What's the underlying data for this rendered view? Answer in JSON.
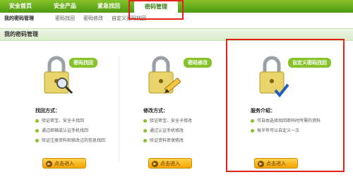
{
  "topnav": {
    "tabs": [
      {
        "label": "安全首页"
      },
      {
        "label": "安全产品"
      },
      {
        "label": "紧急找回"
      },
      {
        "label": "密码管理"
      }
    ]
  },
  "subnav": {
    "items": [
      {
        "label": "我的密码管理"
      },
      {
        "label": "密码找回"
      },
      {
        "label": "密码修改"
      },
      {
        "label": "自定义密码找回"
      }
    ]
  },
  "section_title": "我的密码管理",
  "cards": [
    {
      "bubble": "密码找回",
      "title": "找回方式：",
      "items": [
        "验证密宝、安全卡找回",
        "通过邮箱或认证手机找回",
        "验证注册资料和修改过的信息找回"
      ],
      "button": "点击进入",
      "icon": "magnifier-icon"
    },
    {
      "bubble": "密码修改",
      "title": "修改方式：",
      "items": [
        "验证密宝、安全卡修改",
        "通过认证手机修改",
        "验证资料密保修改"
      ],
      "button": "点击进入",
      "icon": "pencil-icon"
    },
    {
      "bubble": "自定义密码找回",
      "title": "服务介绍：",
      "items": [
        "可自由选择找回密码时所需的资料",
        "每半年可以自定义一次"
      ],
      "button": "点击进入",
      "icon": "checkmark-icon"
    }
  ],
  "colors": {
    "brand_green": "#86c22a",
    "highlight_red": "#e2231a",
    "button_orange": "#f5a300"
  }
}
